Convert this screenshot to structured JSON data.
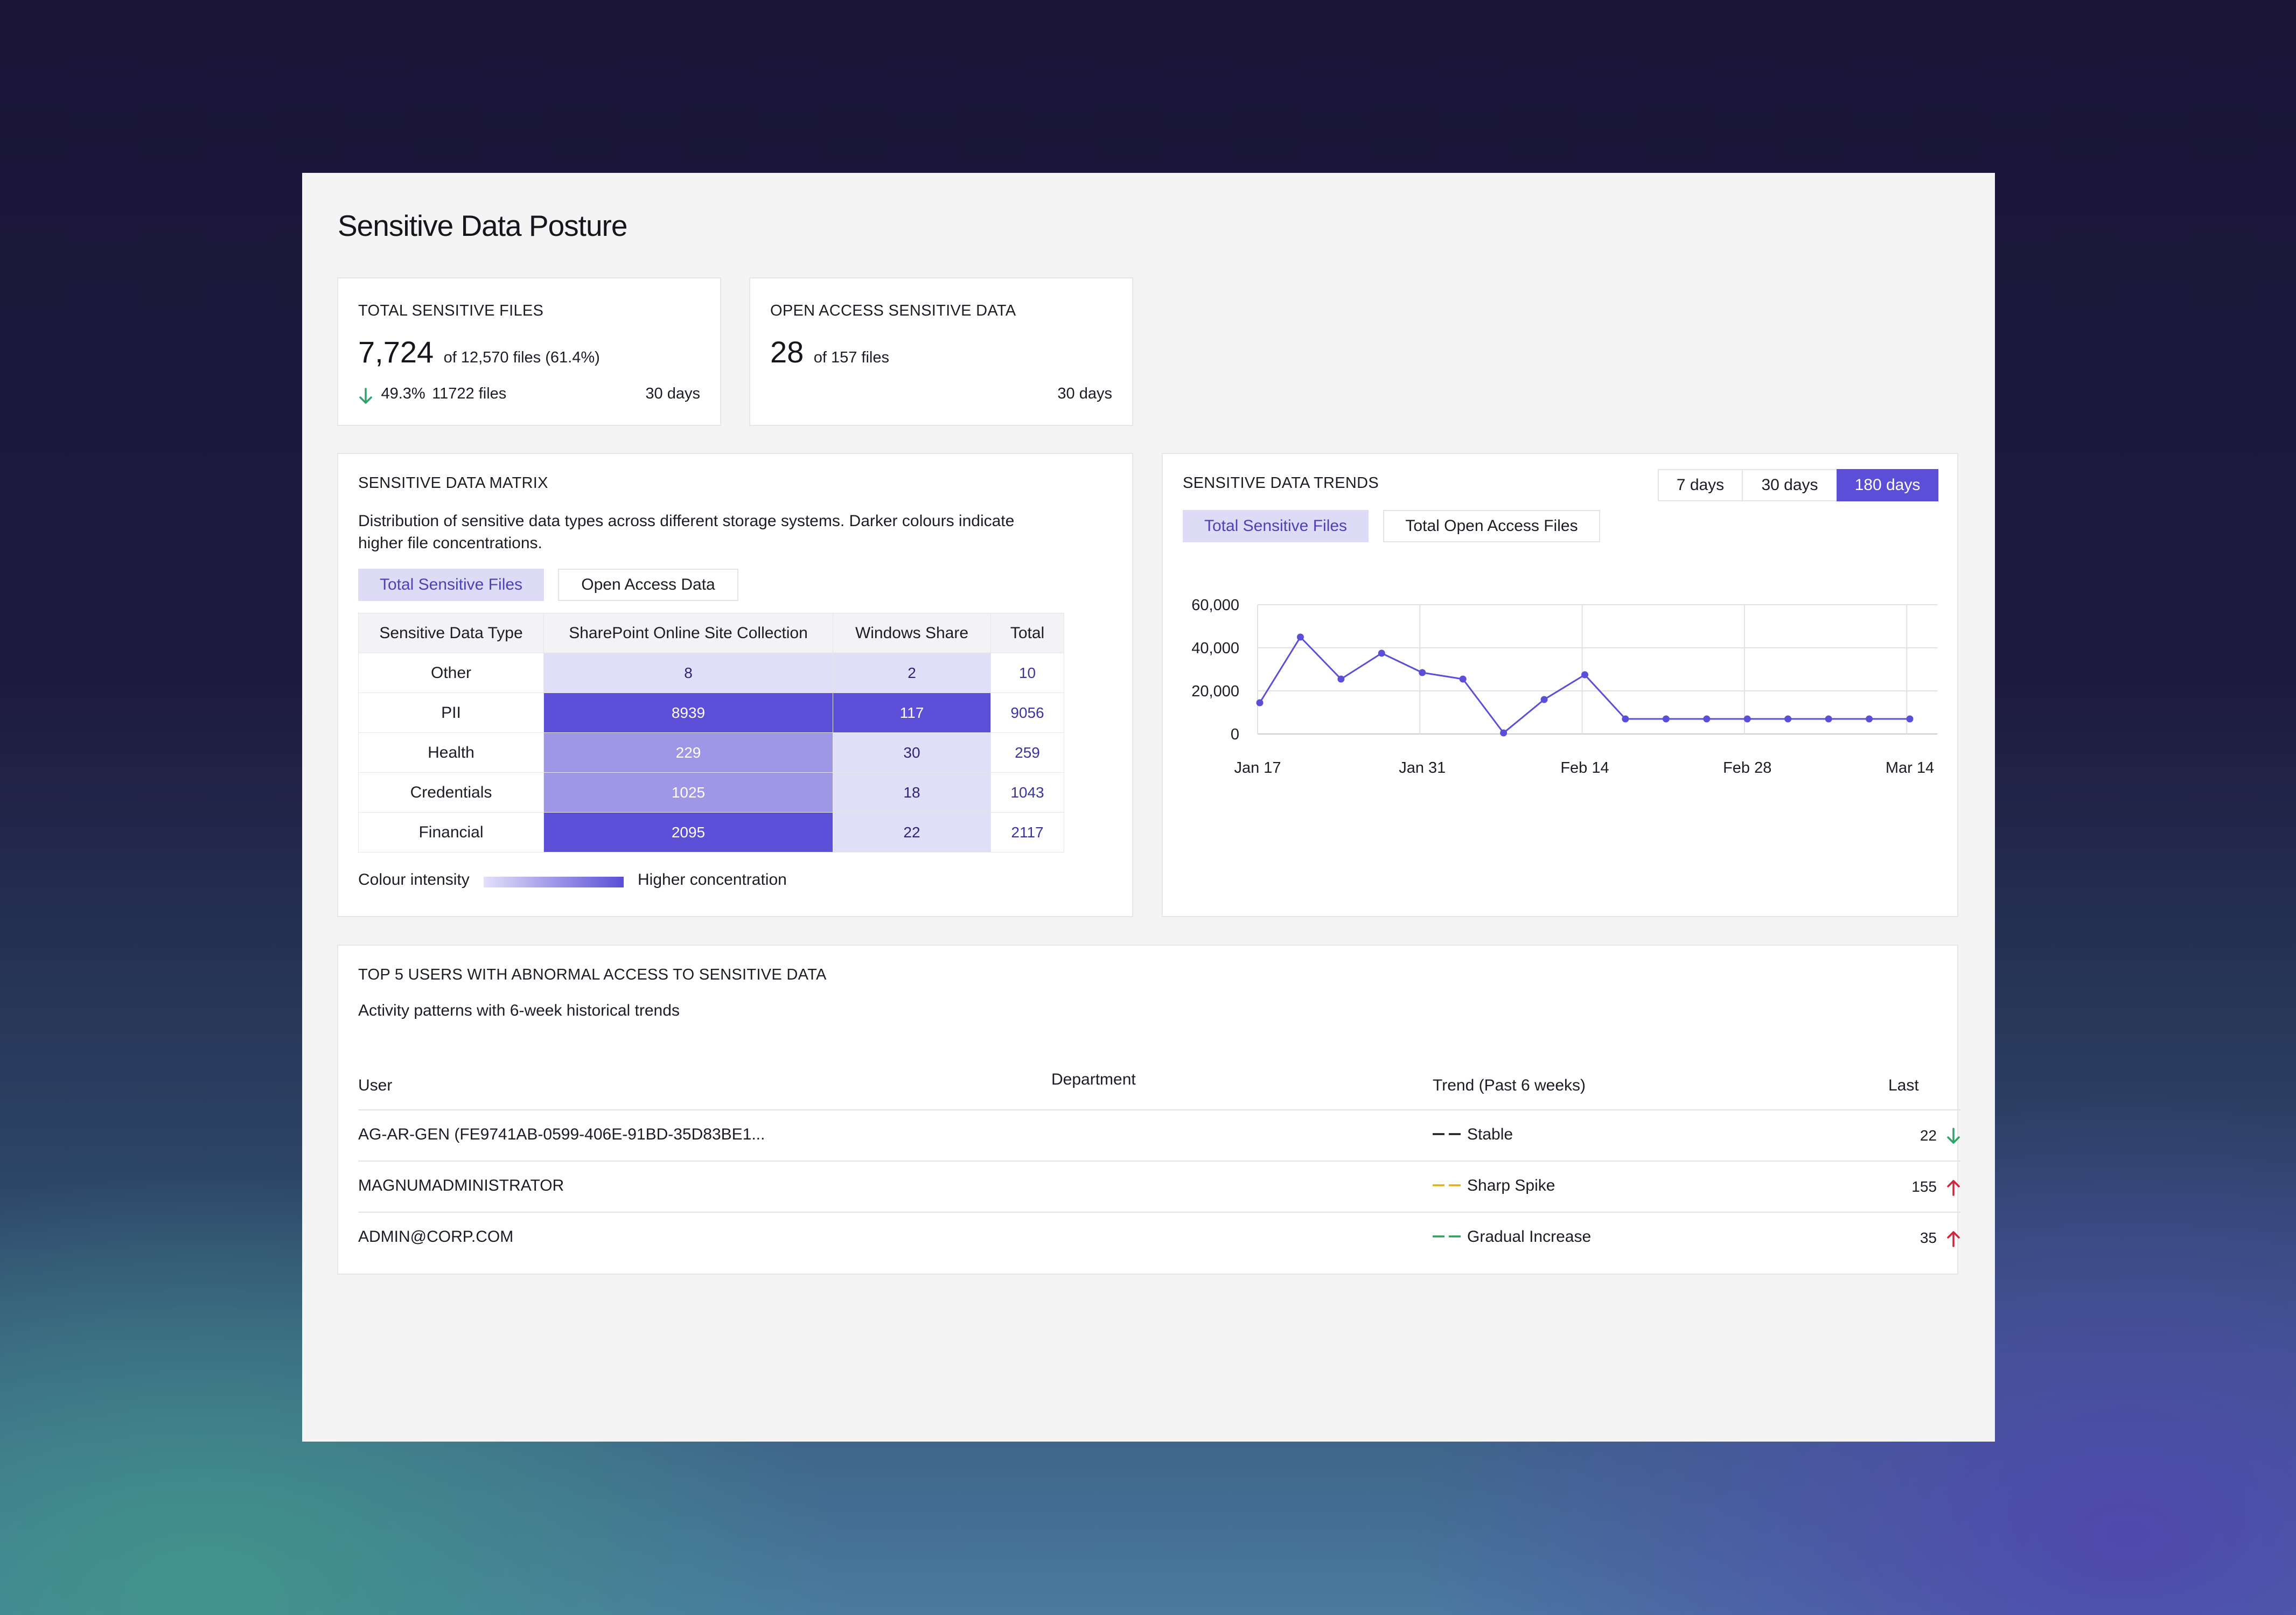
{
  "page": {
    "title": "Sensitive Data Posture"
  },
  "kpis": [
    {
      "title": "TOTAL SENSITIVE FILES",
      "value": "7,724",
      "detail": "of 12,570 files (61.4%)",
      "change_pct": "49.3%",
      "change_files": "11722 files",
      "change_direction": "down",
      "period": "30 days"
    },
    {
      "title": "OPEN ACCESS SENSITIVE DATA",
      "value": "28",
      "detail": "of 157 files",
      "period": "30 days"
    }
  ],
  "matrix": {
    "title": "SENSITIVE DATA MATRIX",
    "description_line1": "Distribution of sensitive data types across different storage systems. Darker colours indicate",
    "description_line2": "higher file concentrations.",
    "tabs": [
      "Total Sensitive Files",
      "Open Access Data"
    ],
    "active_tab": 0,
    "columns": [
      "Sensitive Data Type",
      "SharePoint Online Site Collection",
      "Windows Share",
      "Total"
    ],
    "rows": [
      {
        "type": "Other",
        "sharepoint": "8",
        "windows": "2",
        "total": "10",
        "sharepoint_level": "lo",
        "windows_level": "lo"
      },
      {
        "type": "PII",
        "sharepoint": "8939",
        "windows": "117",
        "total": "9056",
        "sharepoint_level": "hi",
        "windows_level": "hi"
      },
      {
        "type": "Health",
        "sharepoint": "229",
        "windows": "30",
        "total": "259",
        "sharepoint_level": "mid",
        "windows_level": "lo"
      },
      {
        "type": "Credentials",
        "sharepoint": "1025",
        "windows": "18",
        "total": "1043",
        "sharepoint_level": "mid",
        "windows_level": "lo"
      },
      {
        "type": "Financial",
        "sharepoint": "2095",
        "windows": "22",
        "total": "2117",
        "sharepoint_level": "hi",
        "windows_level": "lo"
      }
    ],
    "legend_left": "Colour intensity",
    "legend_right": "Higher concentration"
  },
  "trends": {
    "title": "SENSITIVE DATA TRENDS",
    "ranges": [
      "7 days",
      "30 days",
      "180 days"
    ],
    "active_range": 2,
    "tabs": [
      "Total Sensitive Files",
      "Total Open Access Files"
    ],
    "active_tab": 0,
    "accent": "#5a4fd6"
  },
  "chart_data": {
    "type": "line",
    "x": [
      "Jan 17",
      "Jan 20",
      "Jan 23",
      "Jan 28",
      "Jan 31",
      "Feb 3",
      "Feb 6",
      "Feb 10",
      "Feb 13",
      "Feb 18",
      "Feb 21",
      "Feb 24",
      "Feb 27",
      "Mar 2",
      "Mar 5",
      "Mar 8",
      "Mar 14"
    ],
    "series": [
      {
        "values": [
          14500,
          45000,
          25500,
          37500,
          28500,
          25500,
          500,
          16000,
          27500,
          7000,
          7000,
          7000,
          7000,
          7000,
          7000,
          7000,
          7000
        ]
      }
    ],
    "x_ticks": [
      "Jan 17",
      "Jan 31",
      "Feb 14",
      "Feb 28",
      "Mar 14"
    ],
    "y_ticks": [
      "60,000",
      "40,000",
      "20,000",
      "0"
    ],
    "ylim": [
      0,
      60000
    ],
    "grid": true
  },
  "users": {
    "title": "TOP 5 USERS WITH ABNORMAL ACCESS TO SENSITIVE DATA",
    "subtitle": "Activity patterns with 6-week historical trends",
    "columns": [
      "User",
      "Department",
      "Trend (Past 6 weeks)",
      "Last"
    ],
    "rows": [
      {
        "user": "AG-AR-GEN (FE9741AB-0599-406E-91BD-35D83BE1...",
        "department": "",
        "trend": "Stable",
        "trend_color": "#1c1c24",
        "last": "22",
        "direction": "down"
      },
      {
        "user": "MAGNUMADMINISTRATOR",
        "department": "",
        "trend": "Sharp Spike",
        "trend_color": "#e0b21a",
        "last": "155",
        "direction": "up"
      },
      {
        "user": "ADMIN@CORP.COM",
        "department": "",
        "trend": "Gradual Increase",
        "trend_color": "#2f9e58",
        "last": "35",
        "direction": "up"
      }
    ]
  }
}
